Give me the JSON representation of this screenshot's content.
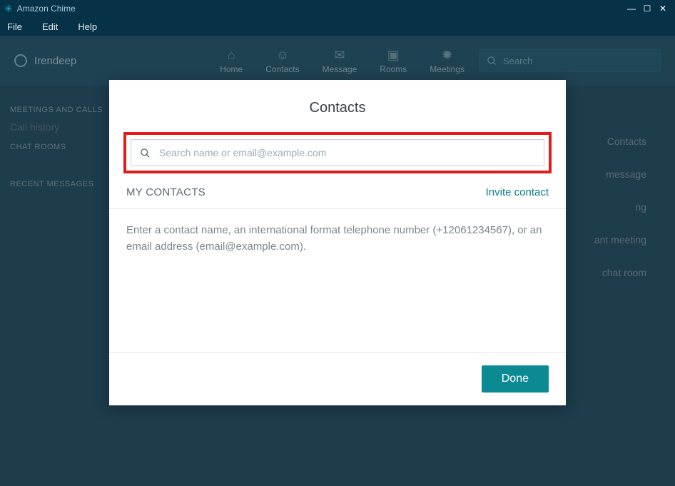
{
  "window": {
    "title": "Amazon Chime"
  },
  "menubar": {
    "file": "File",
    "edit": "Edit",
    "help": "Help"
  },
  "topbar": {
    "username": "Irendeep",
    "nav": {
      "home": "Home",
      "contacts": "Contacts",
      "message": "Message",
      "rooms": "Rooms",
      "meetings": "Meetings"
    },
    "search_placeholder": "Search"
  },
  "left": {
    "section_meetings": "MEETINGS AND CALLS",
    "call_history": "Call history",
    "section_chatrooms": "CHAT ROOMS",
    "section_recent": "RECENT MESSAGES"
  },
  "right": {
    "b1": "Contacts",
    "b2": "message",
    "b3": "ng",
    "b4": "ant meeting",
    "b5": "chat room"
  },
  "modal": {
    "title": "Contacts",
    "search_placeholder": "Search name or email@example.com",
    "my_contacts_label": "MY CONTACTS",
    "invite_label": "Invite contact",
    "hint_text": "Enter a contact name, an international format telephone number (+12061234567), or an email address (email@example.com).",
    "done_label": "Done"
  }
}
